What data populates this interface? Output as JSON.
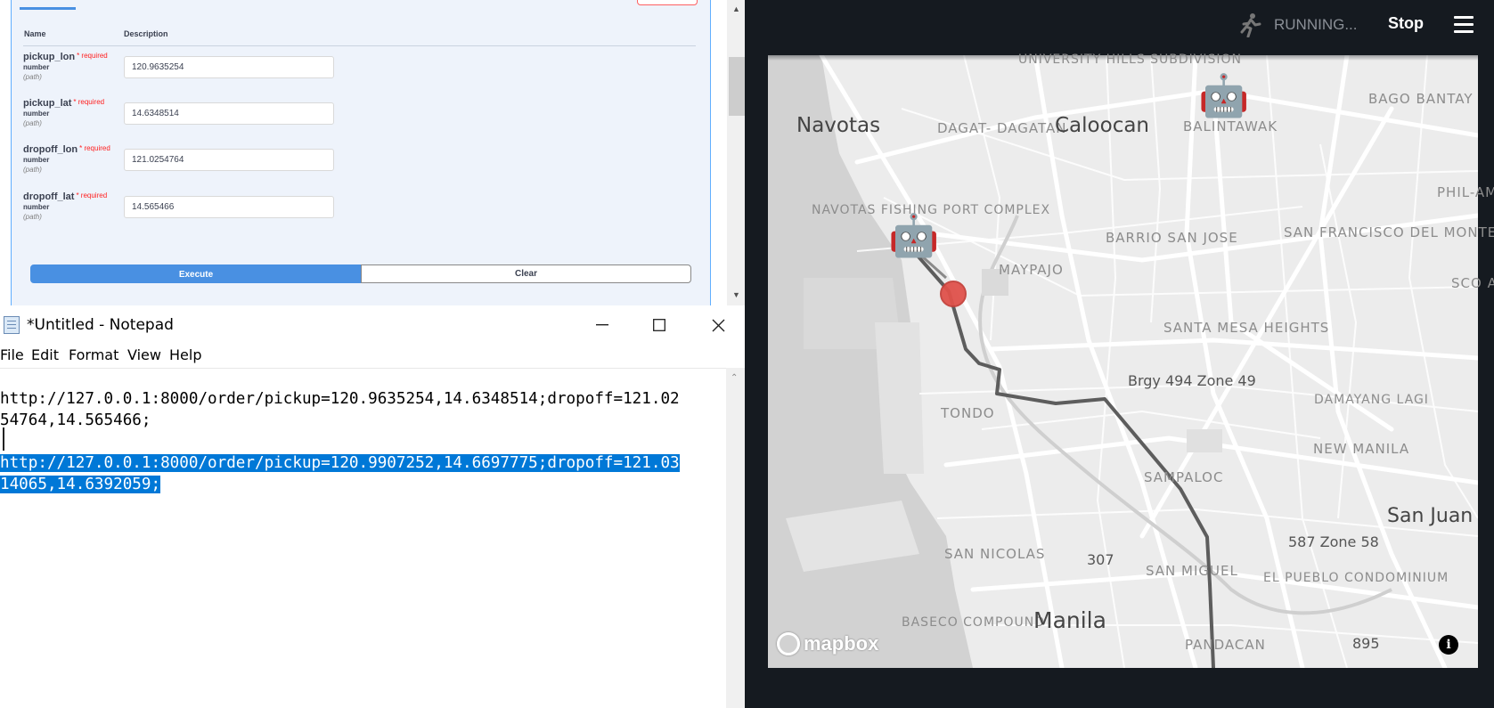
{
  "swagger": {
    "col_name": "Name",
    "col_description": "Description",
    "required_label": "* required",
    "params": [
      {
        "name": "pickup_lon",
        "type": "number",
        "in": "(path)",
        "value": "120.9635254"
      },
      {
        "name": "pickup_lat",
        "type": "number",
        "in": "(path)",
        "value": "14.6348514"
      },
      {
        "name": "dropoff_lon",
        "type": "number",
        "in": "(path)",
        "value": "121.0254764"
      },
      {
        "name": "dropoff_lat",
        "type": "number",
        "in": "(path)",
        "value": "14.565466"
      }
    ],
    "execute_label": "Execute",
    "clear_label": "Clear"
  },
  "notepad": {
    "title": "*Untitled - Notepad",
    "menu": [
      "File",
      "Edit",
      "Format",
      "View",
      "Help"
    ],
    "lines": [
      "http://127.0.0.1:8000/order/pickup=120.9635254,14.6348514;dropoff=121.02",
      "54764,14.565466;",
      "",
      "http://127.0.0.1:8000/order/pickup=120.9907252,14.6697775;dropoff=121.03",
      "14065,14.6392059;"
    ],
    "selected_line_indices": [
      3,
      4
    ]
  },
  "app": {
    "status_text": "RUNNING...",
    "stop_label": "Stop",
    "map_attribution": "mapbox",
    "info_label": "i",
    "robot_glyph": "🤖",
    "map_labels": {
      "university_hills": "UNIVERSITY HILLS SUBDIVISION",
      "navotas": "Navotas",
      "dagat_dagatan": "DAGAT- DAGATAN",
      "caloocan": "Caloocan",
      "balintawak": "BALINTAWAK",
      "bago_bantay": "BAGO BANTAY",
      "phil_am": "PHIL-AM",
      "navotas_fishing": "NAVOTAS FISHING PORT COMPLEX",
      "barrio_san_jose": "BARRIO SAN JOSE",
      "san_francisco": "SAN FRANCISCO DEL MONTE",
      "sco_are": "SCO ARE",
      "maypajo": "MAYPAJO",
      "santa_mesa": "SANTA MESA HEIGHTS",
      "brgy494": "Brgy 494 Zone 49",
      "damayang": "DAMAYANG LAGI",
      "tondo": "TONDO",
      "new_manila": "NEW MANILA",
      "sampaloc": "SAMPALOC",
      "san_juan": "San Juan",
      "zone58": "587 Zone 58",
      "san_nicolas": "SAN NICOLAS",
      "n307": "307",
      "san_miguel": "SAN MIGUEL",
      "el_pueblo": "EL PUEBLO CONDOMINIUM",
      "baseco": "BASECO COMPOUND",
      "manila": "Manila",
      "pandacan": "PANDACAN",
      "n895": "895"
    }
  },
  "colors": {
    "swagger_blue": "#4990e2",
    "selection": "#0078d7",
    "app_bg": "#151a20",
    "route": "#555555",
    "pickup_marker": "#e0524b"
  }
}
